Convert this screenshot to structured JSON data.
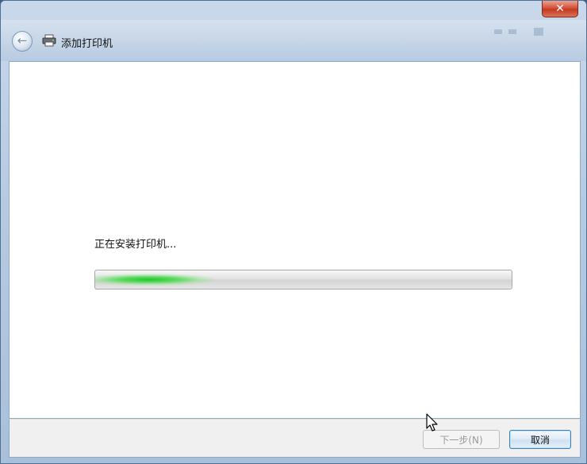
{
  "window": {
    "title": "添加打印机",
    "close_label": "✕"
  },
  "nav": {
    "back_label": "←"
  },
  "installer": {
    "status_text": "正在安装打印机...",
    "progress_fraction": 0.2
  },
  "buttons": {
    "next_label": "下一步(N)",
    "cancel_label": "取消"
  },
  "icons": {
    "back": "back-arrow-icon",
    "printer": "printer-icon",
    "close": "close-icon",
    "cursor": "mouse-cursor-icon"
  }
}
